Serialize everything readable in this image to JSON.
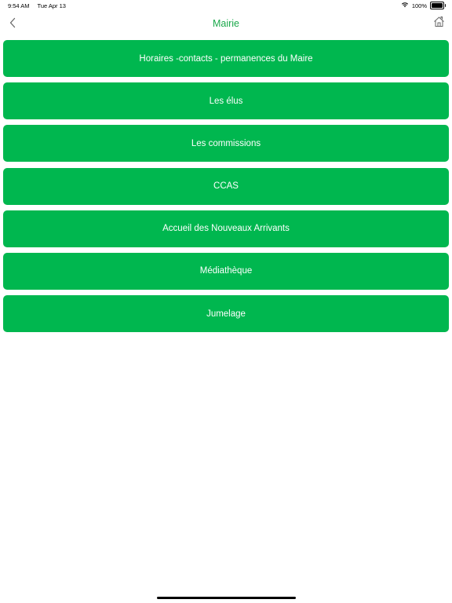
{
  "status_bar": {
    "time": "9:54 AM",
    "date": "Tue Apr 13",
    "battery": "100%",
    "battery_level": 1.0,
    "wifi_icon": "wifi-icon"
  },
  "nav": {
    "title": "Mairie",
    "back_icon": "chevron-left-icon",
    "home_icon": "home-icon",
    "accent_color": "#1aa84a"
  },
  "menu": {
    "button_color": "#00b74f",
    "items": [
      {
        "label": "Horaires -contacts - permanences du Maire"
      },
      {
        "label": "Les élus"
      },
      {
        "label": "Les commissions"
      },
      {
        "label": "CCAS"
      },
      {
        "label": "Accueil des Nouveaux Arrivants"
      },
      {
        "label": "Médiathèque"
      },
      {
        "label": "Jumelage"
      }
    ]
  }
}
